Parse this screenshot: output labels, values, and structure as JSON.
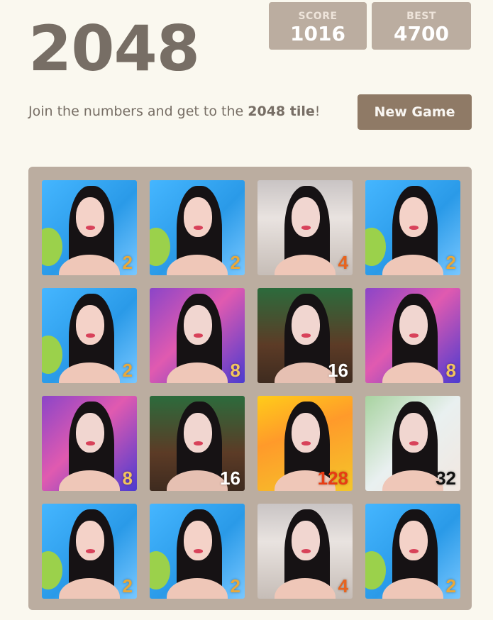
{
  "header": {
    "title": "2048",
    "score_label": "SCORE",
    "score_value": "1016",
    "best_label": "BEST",
    "best_value": "4700"
  },
  "intro": {
    "text_before": "Join the numbers and get to the ",
    "text_bold": "2048 tile",
    "text_after": "!"
  },
  "controls": {
    "new_game_label": "New Game"
  },
  "board": {
    "rows": [
      [
        {
          "value": "2",
          "color": "#e8a83a"
        },
        {
          "value": "2",
          "color": "#e8a83a"
        },
        {
          "value": "4",
          "color": "#e8641e"
        },
        {
          "value": "2",
          "color": "#e8a83a"
        }
      ],
      [
        {
          "value": "2",
          "color": "#e8a83a"
        },
        {
          "value": "8",
          "color": "#f2c45c"
        },
        {
          "value": "16",
          "color": "#ffffff"
        },
        {
          "value": "8",
          "color": "#f2c45c"
        }
      ],
      [
        {
          "value": "8",
          "color": "#f2c45c"
        },
        {
          "value": "16",
          "color": "#ffffff"
        },
        {
          "value": "128",
          "color": "#e83c14"
        },
        {
          "value": "32",
          "color": "#111111"
        }
      ],
      [
        {
          "value": "2",
          "color": "#e8a83a"
        },
        {
          "value": "2",
          "color": "#e8a83a"
        },
        {
          "value": "4",
          "color": "#e8641e"
        },
        {
          "value": "2",
          "color": "#e8a83a"
        }
      ]
    ]
  },
  "colors": {
    "background": "#faf8ef",
    "title": "#776e65",
    "score_box": "#bbada0",
    "button": "#8f7a66",
    "board": "#bbada0"
  }
}
